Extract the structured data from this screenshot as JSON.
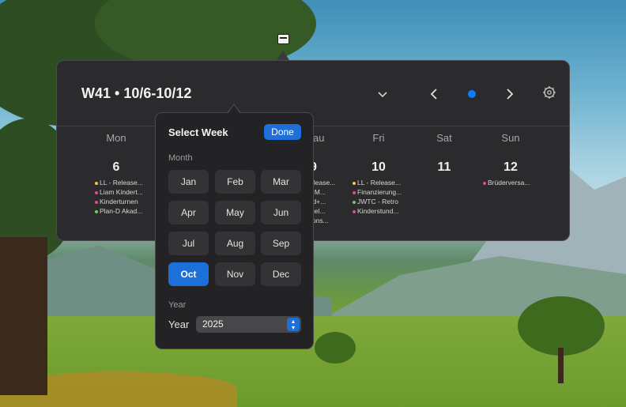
{
  "header": {
    "week_title": "W41 • 10/6-10/12"
  },
  "days": [
    {
      "name": "Mon",
      "num": "6",
      "events": [
        {
          "text": "LL - Release...",
          "color": "#f5c542"
        },
        {
          "text": "Liam Kindert...",
          "color": "#e84a8a"
        },
        {
          "text": "Kinderturnen",
          "color": "#e84a8a"
        },
        {
          "text": "Plan-D Akad...",
          "color": "#6ccf5a"
        }
      ]
    },
    {
      "name": "Thu",
      "num": "9",
      "events": [
        {
          "text": "Release...",
          "color": "#f5c542"
        },
        {
          "text": "rzt M...",
          "color": "#e84a8a"
        },
        {
          "text": "ead+...",
          "color": "#e84a8a"
        },
        {
          "text": "arcel...",
          "color": "#e84a8a"
        },
        {
          "text": "ations...",
          "color": "#e84a8a"
        },
        {
          "text": "3",
          "color": "#8e8e93"
        }
      ]
    },
    {
      "name": "Fri",
      "num": "10",
      "events": [
        {
          "text": "LL - Release...",
          "color": "#f5c542"
        },
        {
          "text": "Finanzierung...",
          "color": "#e84a8a"
        },
        {
          "text": "JWTC - Retro",
          "color": "#6ccf5a"
        },
        {
          "text": "Kinderstund...",
          "color": "#e84a8a"
        }
      ]
    },
    {
      "name": "Sat",
      "num": "11",
      "events": []
    },
    {
      "name": "Sun",
      "num": "12",
      "events": [
        {
          "text": "Brüderversa...",
          "color": "#e84a8a"
        }
      ]
    }
  ],
  "picker": {
    "title": "Select Week",
    "done_label": "Done",
    "month_section": "Month",
    "months": [
      "Jan",
      "Feb",
      "Mar",
      "Apr",
      "May",
      "Jun",
      "Jul",
      "Aug",
      "Sep",
      "Oct",
      "Nov",
      "Dec"
    ],
    "selected_month": "Oct",
    "year_section": "Year",
    "year_label": "Year",
    "year_value": "2025"
  },
  "colors": {
    "accent": "#1d6fd9",
    "today_dot": "#0a7cff"
  }
}
